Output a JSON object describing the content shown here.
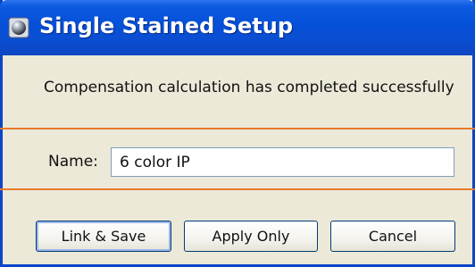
{
  "window": {
    "title": "Single Stained Setup",
    "icon": "app-icon",
    "colors": {
      "titlebar": "#0550d8",
      "accent_line": "#e87a2c",
      "body": "#ece9d8"
    }
  },
  "message": "Compensation calculation has completed successfully",
  "name_field": {
    "label": "Name:",
    "value": "6 color IP"
  },
  "buttons": {
    "link_save": "Link & Save",
    "apply_only": "Apply Only",
    "cancel": "Cancel"
  }
}
